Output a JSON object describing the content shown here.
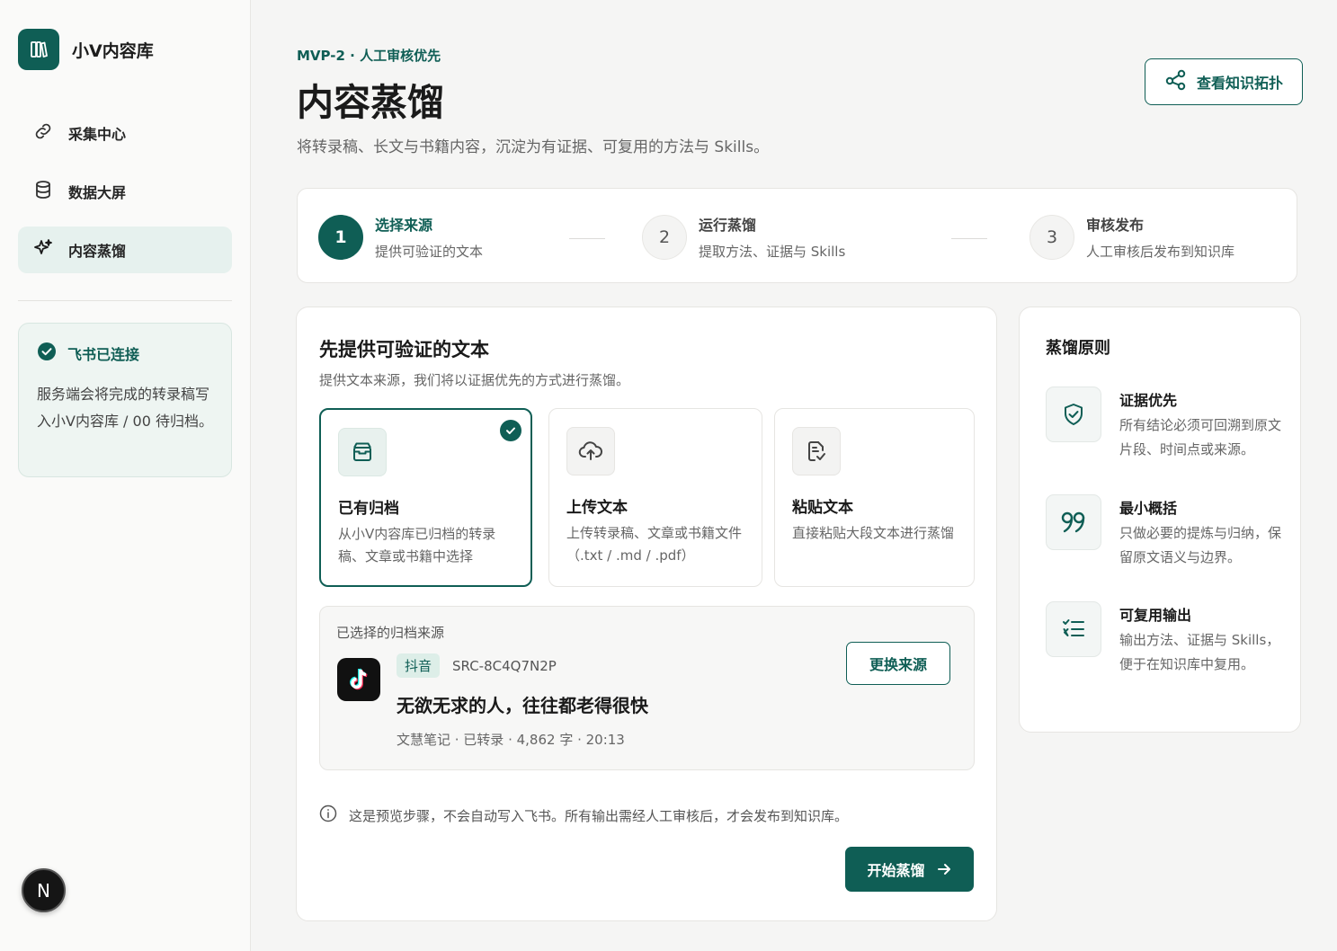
{
  "app": {
    "name": "小V内容库"
  },
  "sidebar": {
    "items": [
      {
        "label": "采集中心",
        "icon": "link-icon",
        "active": false
      },
      {
        "label": "数据大屏",
        "icon": "database-icon",
        "active": false
      },
      {
        "label": "内容蒸馏",
        "icon": "sparkle-icon",
        "active": true
      }
    ],
    "connection": {
      "title": "飞书已连接",
      "desc": "服务端会将完成的转录稿写入小V内容库 / 00 待归档。"
    },
    "avatar": "N"
  },
  "header": {
    "eyebrow": "MVP-2 · 人工审核优先",
    "title": "内容蒸馏",
    "subtitle": "将转录稿、长文与书籍内容，沉淀为有证据、可复用的方法与 Skills。",
    "topo_button": "查看知识拓扑"
  },
  "steps": [
    {
      "num": "1",
      "title": "选择来源",
      "desc": "提供可验证的文本",
      "active": true
    },
    {
      "num": "2",
      "title": "运行蒸馏",
      "desc": "提取方法、证据与 Skills",
      "active": false
    },
    {
      "num": "3",
      "title": "审核发布",
      "desc": "人工审核后发布到知识库",
      "active": false
    }
  ],
  "main": {
    "title": "先提供可验证的文本",
    "subtitle": "提供文本来源，我们将以证据优先的方式进行蒸馏。",
    "options": [
      {
        "title": "已有归档",
        "desc": "从小V内容库已归档的转录稿、文章或书籍中选择",
        "icon": "archive-box-icon",
        "selected": true
      },
      {
        "title": "上传文本",
        "desc": "上传转录稿、文章或书籍文件（.txt / .md / .pdf）",
        "icon": "cloud-upload-icon",
        "selected": false
      },
      {
        "title": "粘贴文本",
        "desc": "直接粘贴大段文本进行蒸馏",
        "icon": "paste-doc-icon",
        "selected": false
      }
    ],
    "source": {
      "label": "已选择的归档来源",
      "platform": "抖音",
      "id": "SRC-8C4Q7N2P",
      "title": "无欲无求的人，往往都老得很快",
      "info": "文慧笔记 · 已转录 · 4,862 字 · 20:13",
      "change_button": "更换来源"
    },
    "note": "这是预览步骤，不会自动写入飞书。所有输出需经人工审核后，才会发布到知识库。",
    "start_button": "开始蒸馏"
  },
  "principles": {
    "title": "蒸馏原则",
    "items": [
      {
        "title": "证据优先",
        "desc": "所有结论必须可回溯到原文片段、时间点或来源。",
        "icon": "shield-check-icon"
      },
      {
        "title": "最小概括",
        "desc": "只做必要的提炼与归纳，保留原文语义与边界。",
        "icon": "quote-icon"
      },
      {
        "title": "可复用输出",
        "desc": "输出方法、证据与 Skills，便于在知识库中复用。",
        "icon": "checklist-icon"
      }
    ]
  },
  "colors": {
    "accent": "#0f5e55",
    "accent_light": "#e6f1ee",
    "background": "#f5f5f4"
  }
}
